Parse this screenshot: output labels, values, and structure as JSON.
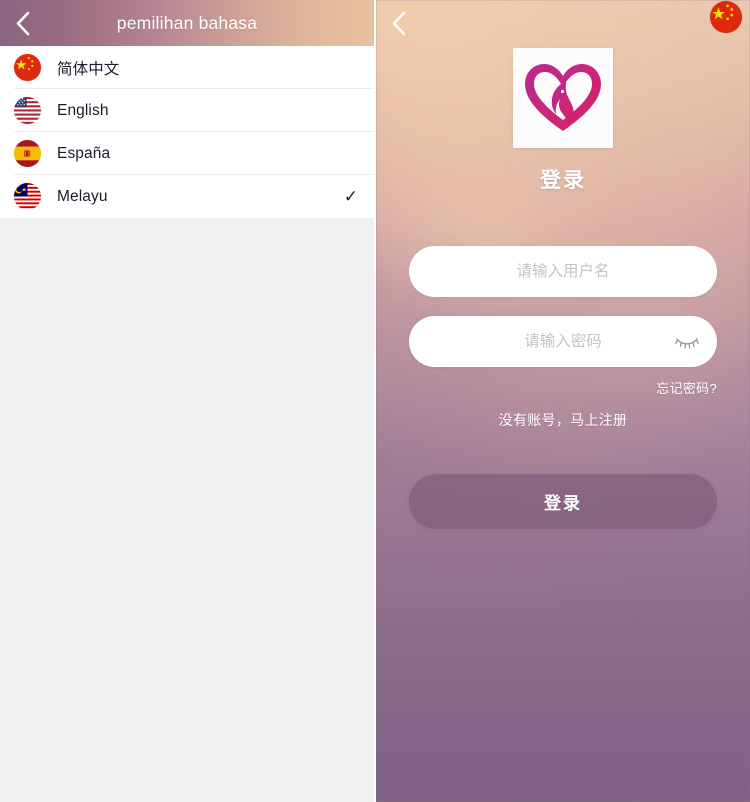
{
  "language_panel": {
    "header": {
      "title": "pemilihan bahasa",
      "back_icon": "chevron-left-icon"
    },
    "items": [
      {
        "label": "简体中文",
        "flag": "flag-china",
        "selected": false,
        "check": "✓"
      },
      {
        "label": "English",
        "flag": "flag-usa",
        "selected": false,
        "check": "✓"
      },
      {
        "label": "España",
        "flag": "flag-spain",
        "selected": false,
        "check": "✓"
      },
      {
        "label": "Melayu",
        "flag": "flag-malaysia",
        "selected": true,
        "check": "✓"
      }
    ]
  },
  "login_panel": {
    "header": {
      "back_icon": "chevron-left-icon",
      "language_flag": "flag-china"
    },
    "logo": {
      "name": "heart-woman-logo",
      "colors": {
        "start": "#c9267e",
        "mid": "#b02a8c",
        "end": "#d1246c"
      }
    },
    "title": "登录",
    "username_field": {
      "value": "",
      "placeholder": "请输入用户名"
    },
    "password_field": {
      "value": "",
      "placeholder": "请输入密码",
      "toggle_icon": "eye-closed-icon"
    },
    "forgot_password_link": "忘记密码?",
    "register_link": "没有账号，马上注册",
    "submit_button": "登录"
  },
  "colors": {
    "header_gradient_start": "#8a6581",
    "header_gradient_end": "#e7c29d",
    "background_top": "#eec8a6",
    "background_bottom": "#816486",
    "list_background": "#ffffff",
    "page_background": "#f1f1f3",
    "accent_pink": "#c9267e",
    "button_fill": "#795875"
  }
}
